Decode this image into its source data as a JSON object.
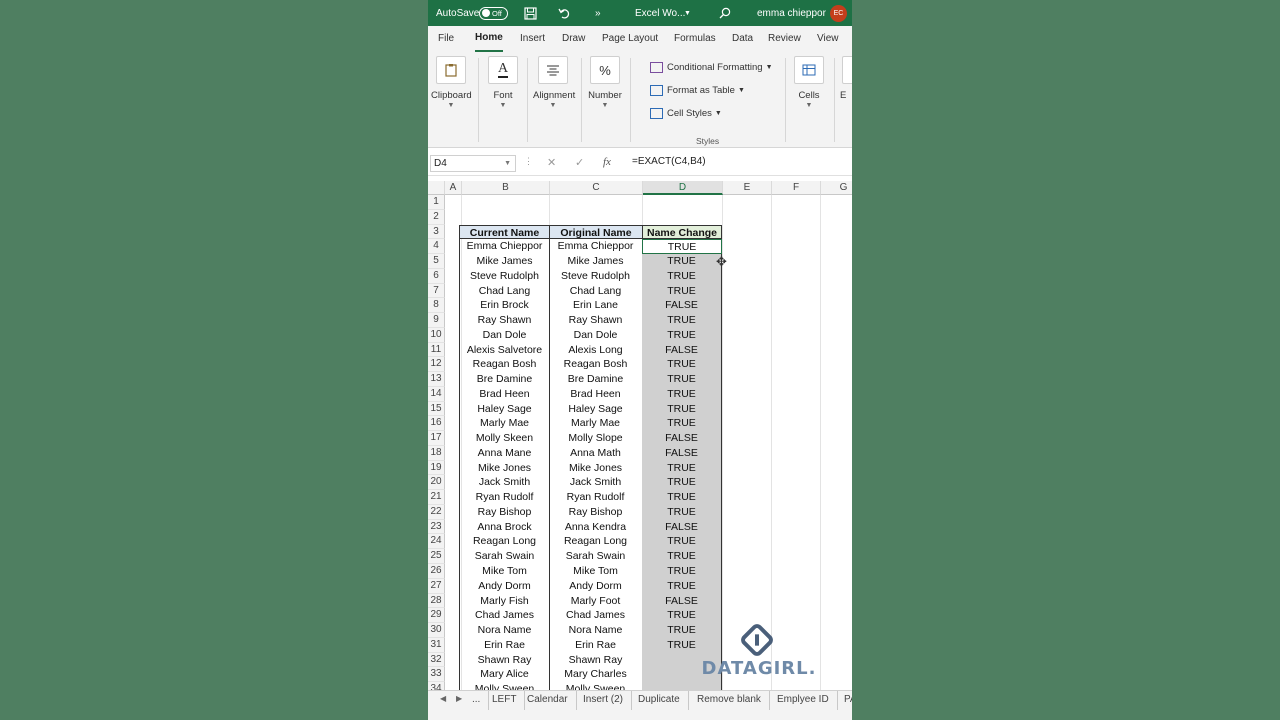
{
  "titlebar": {
    "autosave_label": "AutoSave",
    "autosave_state": "Off",
    "more_label": "»",
    "filename": "Excel Wo...",
    "user_name": "emma chieppor",
    "user_initials": "EC"
  },
  "tabs": [
    "File",
    "Home",
    "Insert",
    "Draw",
    "Page Layout",
    "Formulas",
    "Data",
    "Review",
    "View"
  ],
  "active_tab": "Home",
  "ribbon": {
    "clipboard": "Clipboard",
    "font": "Font",
    "alignment": "Alignment",
    "number": "Number",
    "number_icon": "%",
    "conditional_formatting": "Conditional Formatting",
    "format_as_table": "Format as Table",
    "cell_styles": "Cell Styles",
    "styles_group": "Styles",
    "cells": "Cells",
    "editing_partial": "E"
  },
  "formula_bar": {
    "name_box": "D4",
    "formula": "=EXACT(C4,B4)",
    "fx": "fx"
  },
  "columns": [
    "A",
    "B",
    "C",
    "D",
    "E",
    "F",
    "G"
  ],
  "headers": {
    "current": "Current Name",
    "original": "Original Name",
    "change": "Name Change"
  },
  "rows": [
    {
      "current": "Emma Chieppor",
      "original": "Emma Chieppor",
      "change": "TRUE"
    },
    {
      "current": "Mike James",
      "original": "Mike James",
      "change": "TRUE"
    },
    {
      "current": "Steve Rudolph",
      "original": "Steve Rudolph",
      "change": "TRUE"
    },
    {
      "current": "Chad Lang",
      "original": "Chad Lang",
      "change": "TRUE"
    },
    {
      "current": "Erin Brock",
      "original": "Erin Lane",
      "change": "FALSE"
    },
    {
      "current": "Ray Shawn",
      "original": "Ray Shawn",
      "change": "TRUE"
    },
    {
      "current": "Dan Dole",
      "original": "Dan Dole",
      "change": "TRUE"
    },
    {
      "current": "Alexis Salvetore",
      "original": "Alexis Long",
      "change": "FALSE"
    },
    {
      "current": "Reagan Bosh",
      "original": "Reagan Bosh",
      "change": "TRUE"
    },
    {
      "current": "Bre Damine",
      "original": "Bre Damine",
      "change": "TRUE"
    },
    {
      "current": "Brad Heen",
      "original": "Brad Heen",
      "change": "TRUE"
    },
    {
      "current": "Haley Sage",
      "original": "Haley Sage",
      "change": "TRUE"
    },
    {
      "current": "Marly Mae",
      "original": "Marly Mae",
      "change": "TRUE"
    },
    {
      "current": "Molly Skeen",
      "original": "Molly Slope",
      "change": "FALSE"
    },
    {
      "current": "Anna Mane",
      "original": "Anna Math",
      "change": "FALSE"
    },
    {
      "current": "Mike Jones",
      "original": "Mike Jones",
      "change": "TRUE"
    },
    {
      "current": "Jack Smith",
      "original": "Jack Smith",
      "change": "TRUE"
    },
    {
      "current": "Ryan Rudolf",
      "original": "Ryan Rudolf",
      "change": "TRUE"
    },
    {
      "current": "Ray Bishop",
      "original": "Ray Bishop",
      "change": "TRUE"
    },
    {
      "current": "Anna Brock",
      "original": "Anna Kendra",
      "change": "FALSE"
    },
    {
      "current": "Reagan Long",
      "original": "Reagan Long",
      "change": "TRUE"
    },
    {
      "current": "Sarah Swain",
      "original": "Sarah Swain",
      "change": "TRUE"
    },
    {
      "current": "Mike Tom",
      "original": "Mike Tom",
      "change": "TRUE"
    },
    {
      "current": "Andy Dorm",
      "original": "Andy Dorm",
      "change": "TRUE"
    },
    {
      "current": "Marly Fish",
      "original": "Marly Foot",
      "change": "FALSE"
    },
    {
      "current": "Chad James",
      "original": "Chad James",
      "change": "TRUE"
    },
    {
      "current": "Nora Name",
      "original": "Nora Name",
      "change": "TRUE"
    },
    {
      "current": "Erin Rae",
      "original": "Erin Rae",
      "change": "TRUE"
    },
    {
      "current": "Shawn Ray",
      "original": "Shawn Ray",
      "change": ""
    },
    {
      "current": "Mary Alice",
      "original": "Mary Charles",
      "change": ""
    },
    {
      "current": "Molly Sween",
      "original": "Molly Sween",
      "change": ""
    }
  ],
  "sheet_tabs": [
    "...",
    "LEFT",
    "Calendar",
    "Insert (2)",
    "Duplicate",
    "Remove blank",
    "Emplyee ID",
    "PA"
  ],
  "watermark": "DATAGIRL.",
  "colors": {
    "excel_green": "#1e7145",
    "header_blue": "#dce6f1",
    "header_green": "#e2efda",
    "selection_gray": "#d0d0d0",
    "background": "#4f7f61"
  }
}
